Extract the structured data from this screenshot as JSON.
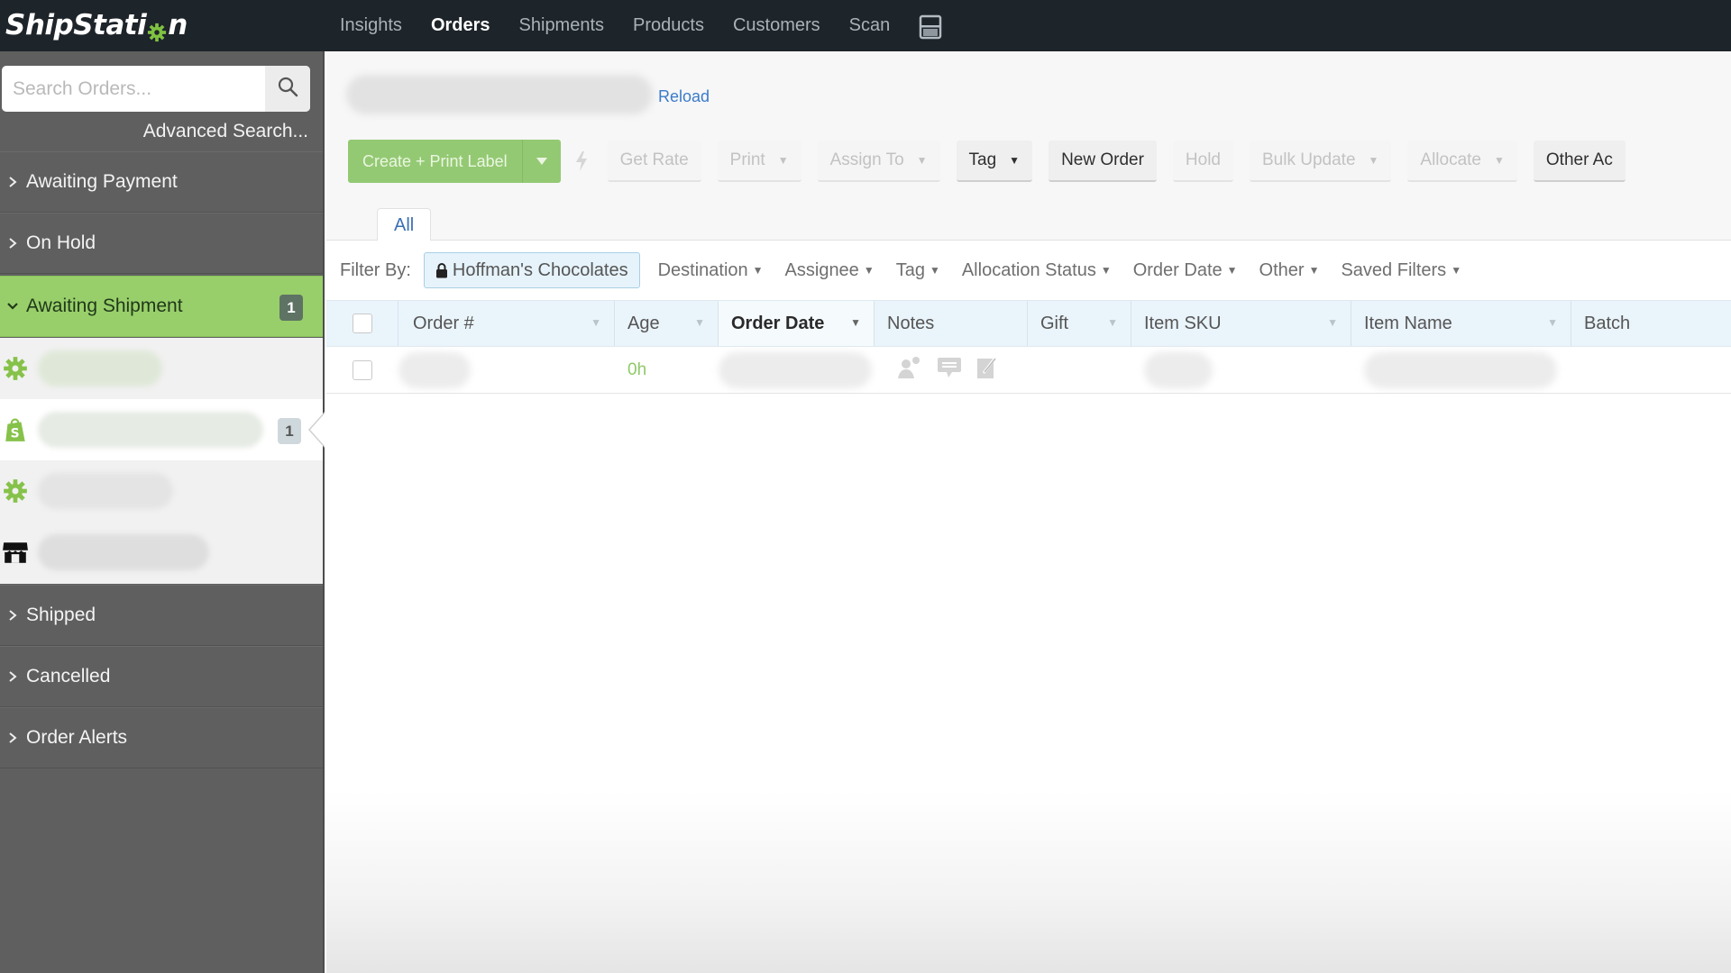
{
  "app": {
    "logo_text_before": "ShipStati",
    "logo_text_after": "n",
    "logo_gear_icon": "gear-icon",
    "brand_green": "#7fc241"
  },
  "topnav": {
    "items": [
      {
        "label": "Insights",
        "active": false
      },
      {
        "label": "Orders",
        "active": true
      },
      {
        "label": "Shipments",
        "active": false
      },
      {
        "label": "Products",
        "active": false
      },
      {
        "label": "Customers",
        "active": false
      },
      {
        "label": "Scan",
        "active": false
      }
    ],
    "extra_icon": "scale-printer-icon"
  },
  "sidebar": {
    "search_placeholder": "Search Orders...",
    "search_value": "",
    "advanced_search": "Advanced Search...",
    "statuses": [
      {
        "label": "Awaiting Payment",
        "expanded": false
      },
      {
        "label": "On Hold",
        "expanded": false
      },
      {
        "label": "Awaiting Shipment",
        "expanded": true,
        "count": "1"
      },
      {
        "label": "Shipped",
        "expanded": false
      },
      {
        "label": "Cancelled",
        "expanded": false
      },
      {
        "label": "Order Alerts",
        "expanded": false
      }
    ],
    "stores": [
      {
        "icon": "gear-store-icon",
        "name": "",
        "count": null,
        "selected": false
      },
      {
        "icon": "shopify-icon",
        "name": "",
        "count": "1",
        "selected": true
      },
      {
        "icon": "gear-store-icon",
        "name": "",
        "count": null,
        "selected": false
      },
      {
        "icon": "storefront-icon",
        "name": "",
        "count": null,
        "selected": false
      }
    ],
    "active_color": "#98cf6a"
  },
  "main": {
    "store_title": "",
    "reload": "Reload",
    "toolbar": {
      "create_print_label": "Create + Print Label",
      "buttons": [
        {
          "label": "Get Rate",
          "dropdown": false,
          "enabled": false
        },
        {
          "label": "Print",
          "dropdown": true,
          "enabled": false
        },
        {
          "label": "Assign To",
          "dropdown": true,
          "enabled": false
        },
        {
          "label": "Tag",
          "dropdown": true,
          "enabled": true
        },
        {
          "label": "New Order",
          "dropdown": false,
          "enabled": true
        },
        {
          "label": "Hold",
          "dropdown": false,
          "enabled": false
        },
        {
          "label": "Bulk Update",
          "dropdown": true,
          "enabled": false
        },
        {
          "label": "Allocate",
          "dropdown": true,
          "enabled": false
        },
        {
          "label": "Other Ac",
          "dropdown": false,
          "enabled": true
        }
      ]
    },
    "tabs": [
      {
        "label": "All",
        "active": true
      }
    ],
    "filter_bar": {
      "label": "Filter By:",
      "active_chip": "Hoffman's Chocolates",
      "dropdowns": [
        "Destination",
        "Assignee",
        "Tag",
        "Allocation Status",
        "Order Date",
        "Other",
        "Saved Filters"
      ]
    },
    "table": {
      "columns": [
        {
          "label": "Order #",
          "sorted": false
        },
        {
          "label": "Age",
          "sorted": false
        },
        {
          "label": "Order Date",
          "sorted": true
        },
        {
          "label": "Notes",
          "sorted": false,
          "no_sort": true
        },
        {
          "label": "Gift",
          "sorted": false
        },
        {
          "label": "Item SKU",
          "sorted": false
        },
        {
          "label": "Item Name",
          "sorted": false
        },
        {
          "label": "Batch",
          "sorted": false,
          "no_sort": true
        }
      ],
      "rows": [
        {
          "order_number": "",
          "age": "0h",
          "order_date": "",
          "notes_icons": [
            "assign-user-icon",
            "message-icon",
            "edit-note-icon"
          ],
          "gift": "",
          "item_sku": "",
          "item_name": "",
          "batch": ""
        }
      ]
    }
  }
}
